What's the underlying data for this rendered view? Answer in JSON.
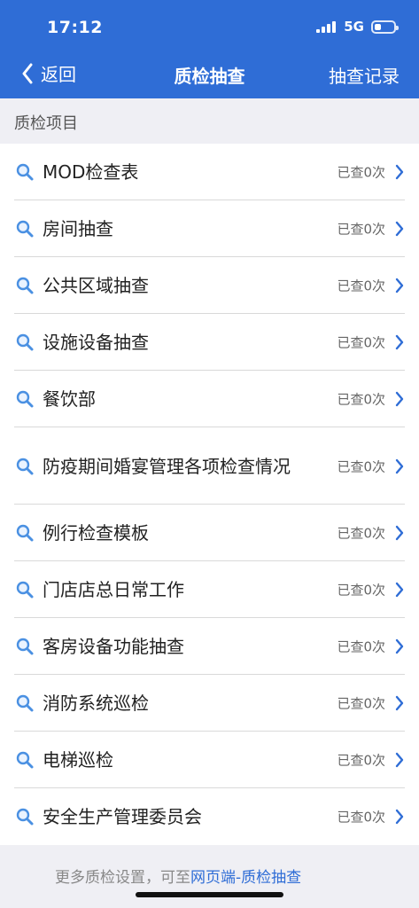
{
  "status_bar": {
    "time": "17:12",
    "network": "5G",
    "battery_level": 0.25
  },
  "nav": {
    "back_label": "返回",
    "title": "质检抽查",
    "right_action": "抽查记录"
  },
  "section": {
    "title": "质检项目"
  },
  "items": [
    {
      "label": "MOD检查表",
      "count": "已查0次"
    },
    {
      "label": "房间抽查",
      "count": "已查0次"
    },
    {
      "label": "公共区域抽查",
      "count": "已查0次"
    },
    {
      "label": "设施设备抽查",
      "count": "已查0次"
    },
    {
      "label": "餐饮部",
      "count": "已查0次"
    },
    {
      "label": "防疫期间婚宴管理各项检查情况",
      "count": "已查0次"
    },
    {
      "label": "例行检查模板",
      "count": "已查0次"
    },
    {
      "label": "门店店总日常工作",
      "count": "已查0次"
    },
    {
      "label": "客房设备功能抽查",
      "count": "已查0次"
    },
    {
      "label": "消防系统巡检",
      "count": "已查0次"
    },
    {
      "label": "电梯巡检",
      "count": "已查0次"
    },
    {
      "label": "安全生产管理委员会",
      "count": "已查0次"
    }
  ],
  "footer": {
    "prefix": "更多质检设置，可至",
    "link": "网页端-质检抽查"
  },
  "colors": {
    "header_bg": "#2f6dd6",
    "link": "#2f6dd6",
    "icon": "#4a90e2"
  },
  "icons": {
    "back": "chevron-left-icon",
    "item": "search-icon",
    "row_arrow": "chevron-right-icon"
  }
}
